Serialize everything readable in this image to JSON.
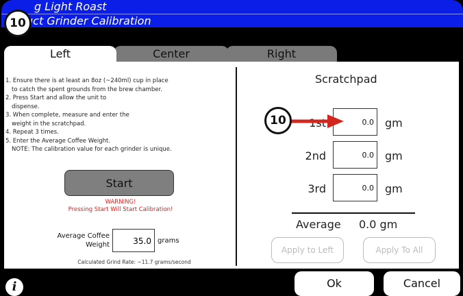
{
  "header": {
    "title_line1": "g Light Roast",
    "title_line2": "uct Grinder Calibration"
  },
  "tabs": [
    {
      "label": "Left",
      "active": true
    },
    {
      "label": "Center",
      "active": false
    },
    {
      "label": "Right",
      "active": false
    }
  ],
  "instructions": [
    "1. Ensure there is at least an 8oz (~240ml) cup in place",
    "   to catch the spent grounds from the brew chamber.",
    "2. Press Start and allow the unit to",
    "   dispense.",
    "3. When complete, measure and enter the",
    "   weight in the scratchpad.",
    "4. Repeat 3 times.",
    "5. Enter the Average Coffee Weight.",
    "   NOTE:  The calibration value for each grinder is unique."
  ],
  "start_button": "Start",
  "warning": {
    "line1": "WARNING!",
    "line2": "Pressing Start Will Start Calibration!"
  },
  "average_weight": {
    "label_line1": "Average Coffee",
    "label_line2": "Weight",
    "value": "35.0",
    "unit": "grams"
  },
  "grind_rate": "Calculated Grind Rate: ~11.7 grams/second",
  "scratchpad": {
    "title": "Scratchpad",
    "rows": [
      {
        "label": "1st",
        "value": "0.0",
        "unit": "gm"
      },
      {
        "label": "2nd",
        "value": "0.0",
        "unit": "gm"
      },
      {
        "label": "3rd",
        "value": "0.0",
        "unit": "gm"
      }
    ],
    "average_label": "Average",
    "average_value": "0.0 gm",
    "apply_left": "Apply to Left",
    "apply_all": "Apply To All"
  },
  "footer": {
    "info": "i",
    "ok": "Ok",
    "cancel": "Cancel"
  },
  "callouts": {
    "badge_top": "10",
    "badge_scratch": "10"
  },
  "colors": {
    "header_blue": "#0a1ee8",
    "arrow_red": "#d0281e",
    "warning_red": "#e02020"
  }
}
